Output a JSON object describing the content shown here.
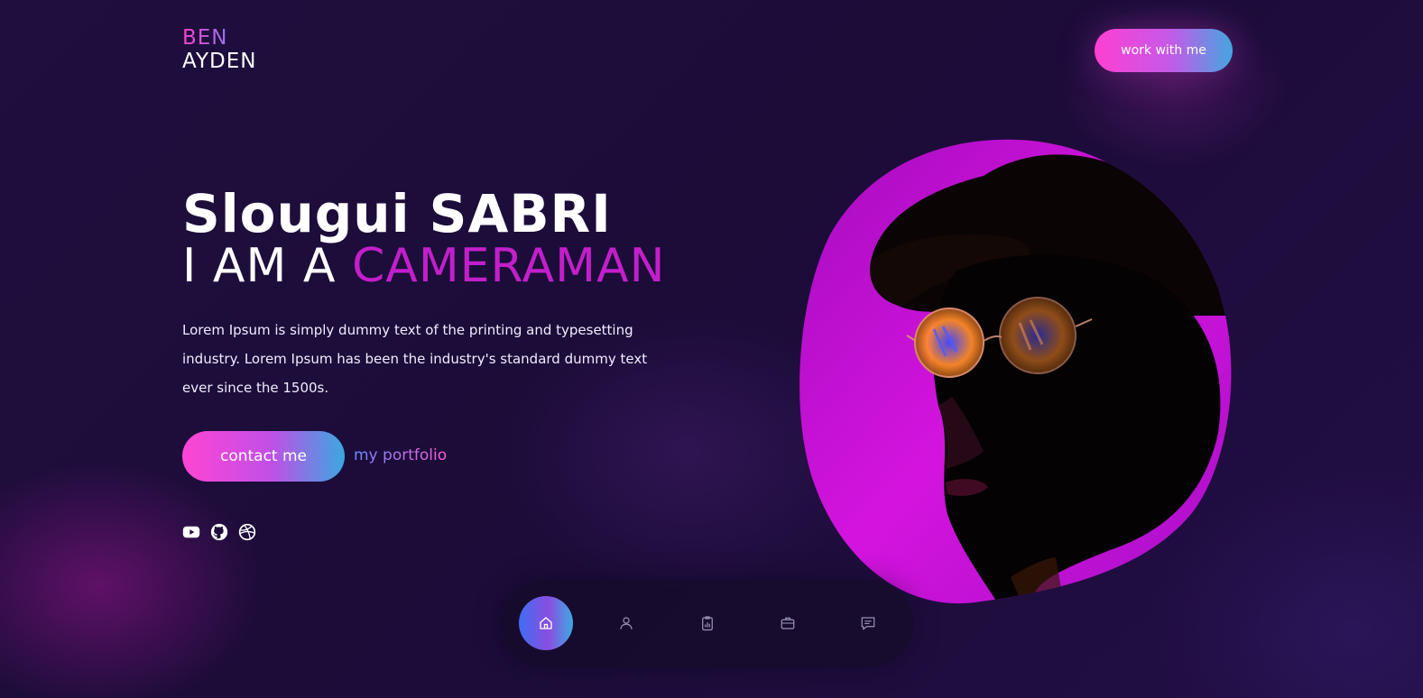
{
  "logo": {
    "first": "BEN",
    "last": "AYDEN"
  },
  "header": {
    "cta_label": "work with me"
  },
  "hero": {
    "name": "Slougui SABRI",
    "role_prefix": "I AM A ",
    "role_accent": "CAMERAMAN",
    "description": "Lorem Ipsum is simply dummy text of the printing and typesetting industry. Lorem Ipsum has been the industry's standard dummy text ever since the 1500s.",
    "contact_label": "contact me",
    "portfolio_label": "my portfolio"
  },
  "socials": [
    {
      "icon": "youtube-icon"
    },
    {
      "icon": "github-icon"
    },
    {
      "icon": "dribbble-icon"
    }
  ],
  "nav": {
    "items": [
      {
        "icon": "home-icon",
        "active": true
      },
      {
        "icon": "user-icon",
        "active": false
      },
      {
        "icon": "clipboard-chart-icon",
        "active": false
      },
      {
        "icon": "briefcase-icon",
        "active": false
      },
      {
        "icon": "message-icon",
        "active": false
      }
    ]
  },
  "colors": {
    "accent_magenta": "#c21fcb",
    "gradient_pink": "#ff3fd2",
    "gradient_blue": "#43a7e0",
    "background": "#1f0f3f"
  }
}
